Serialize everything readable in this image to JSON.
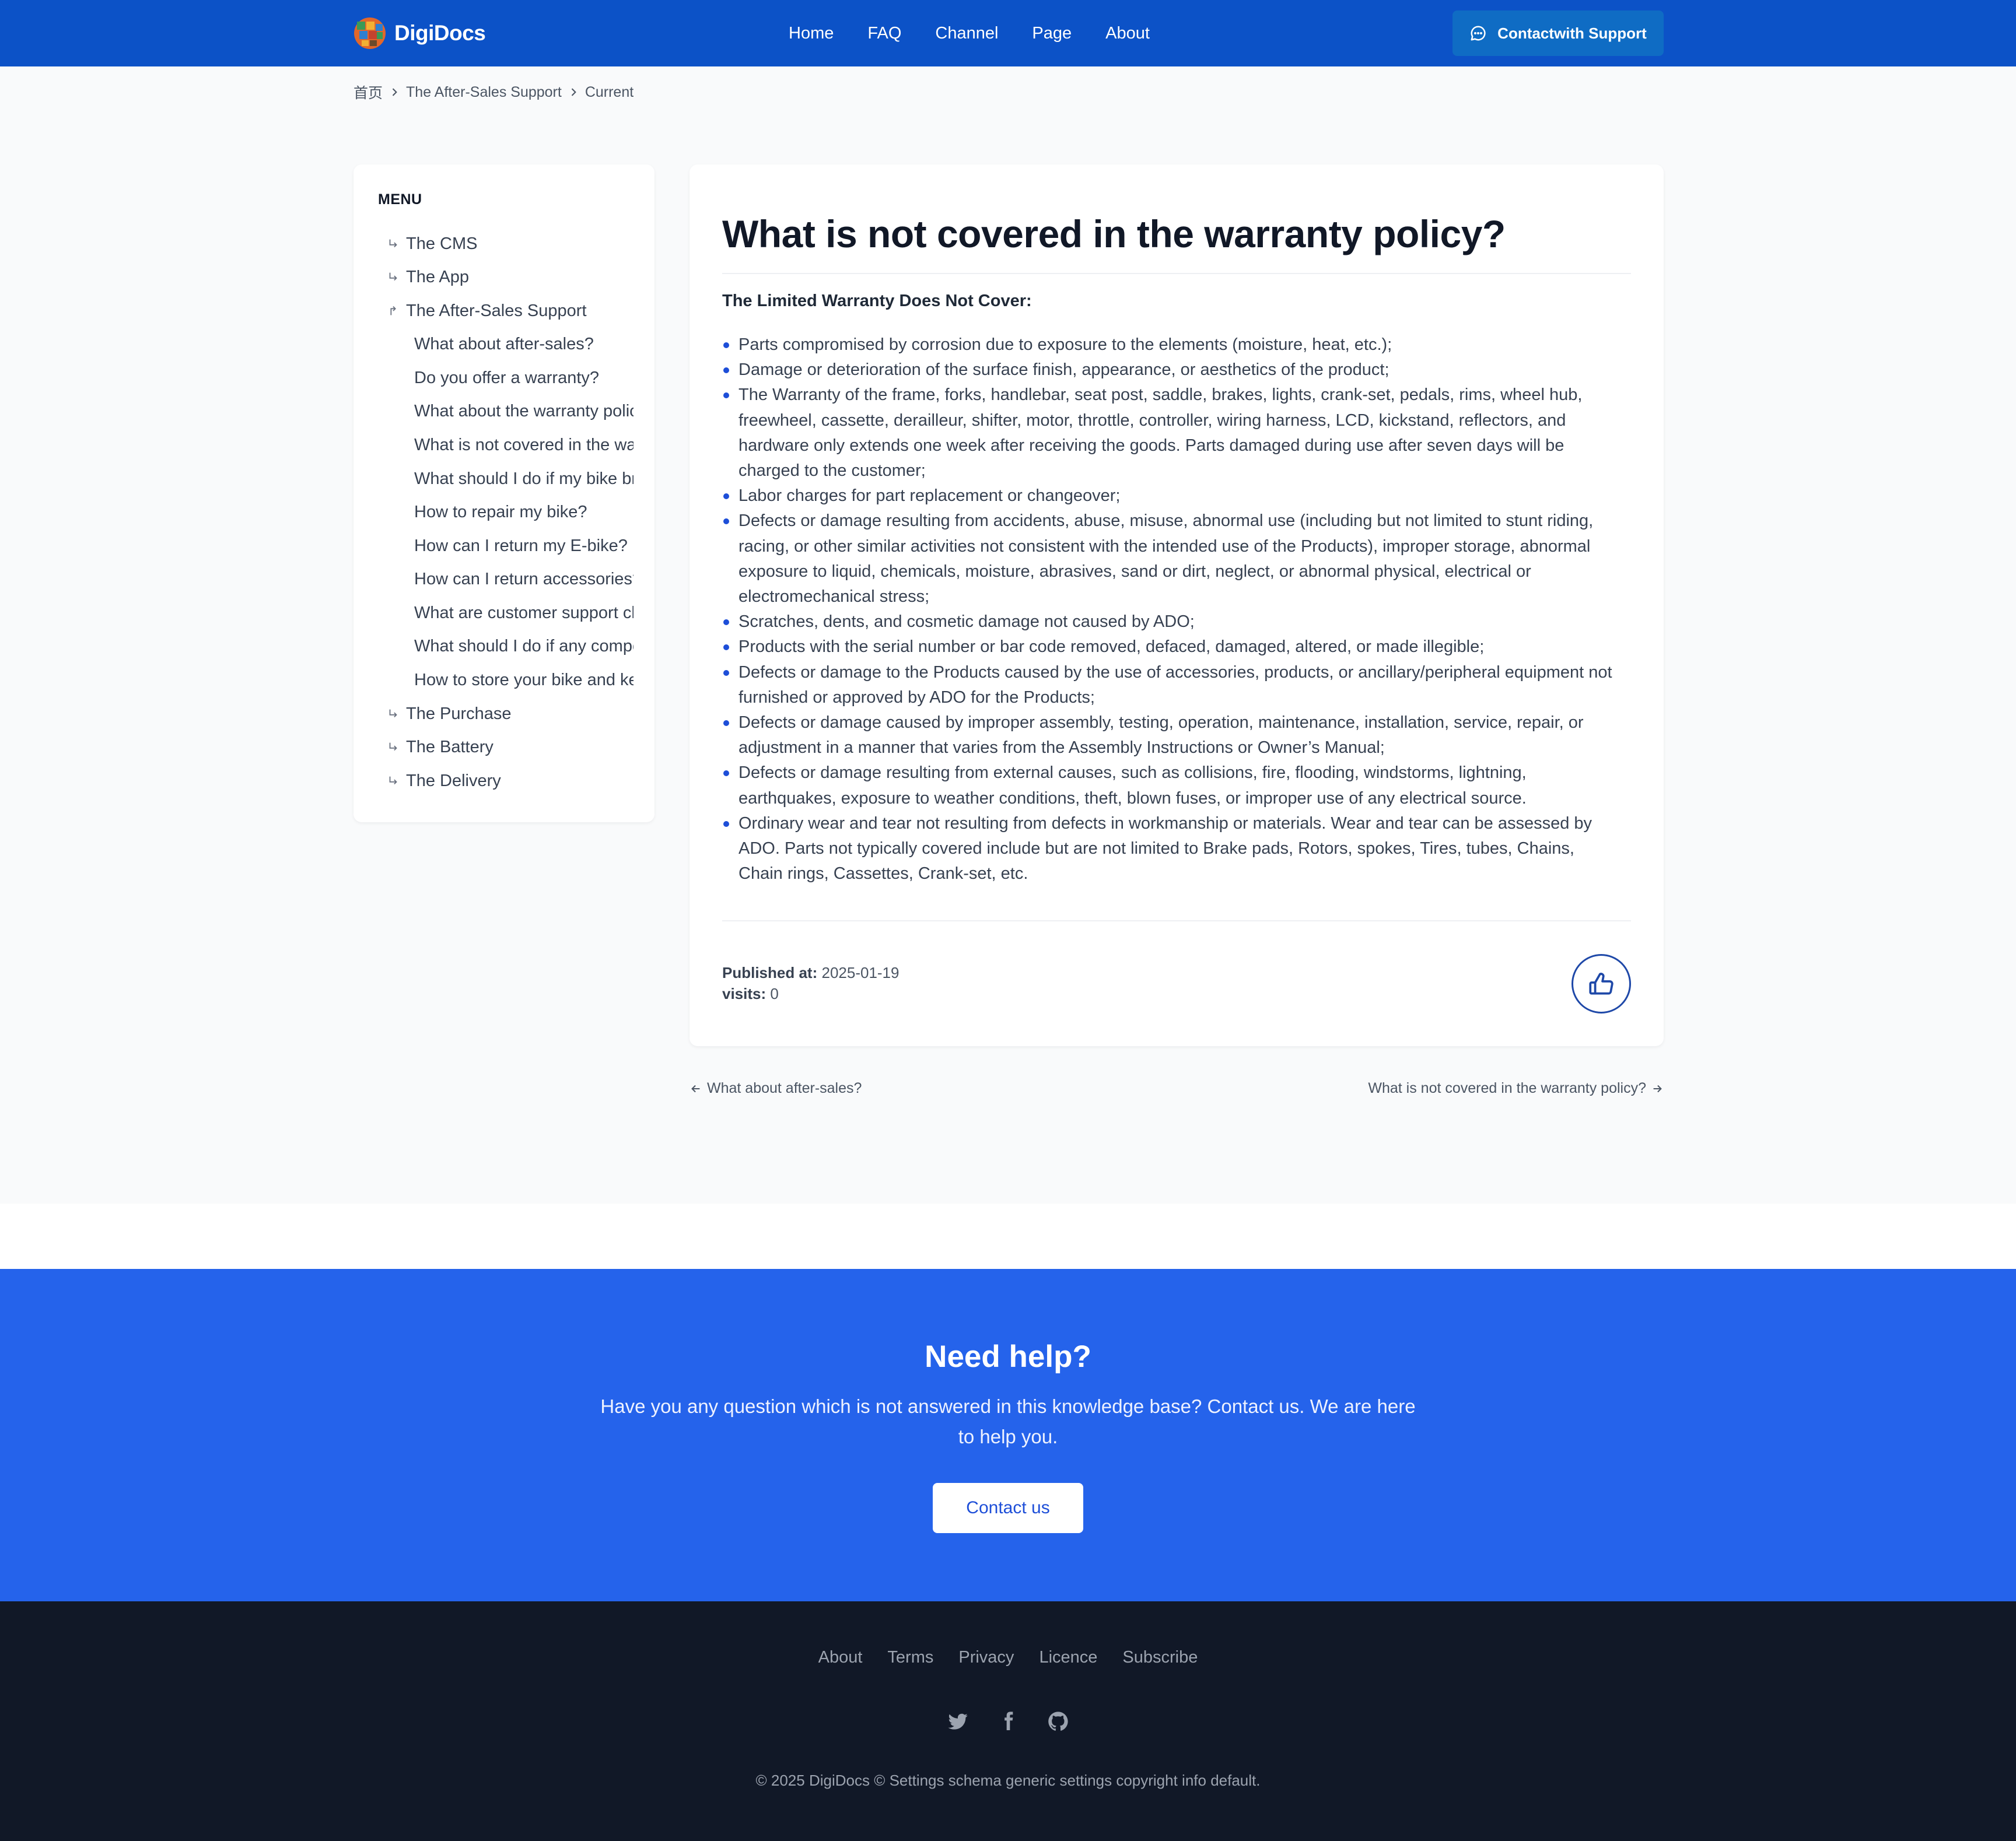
{
  "header": {
    "brand": "DigiDocs",
    "nav": [
      "Home",
      "FAQ",
      "Channel",
      "Page",
      "About"
    ],
    "support_button": "Contactwith Support"
  },
  "breadcrumb": [
    "首页",
    "The After-Sales Support",
    "Current"
  ],
  "sidebar": {
    "title": "MENU",
    "sections": [
      {
        "label": "The CMS",
        "expanded": false
      },
      {
        "label": "The App",
        "expanded": false
      },
      {
        "label": "The After-Sales Support",
        "expanded": true
      },
      {
        "label": "The Purchase",
        "expanded": false
      },
      {
        "label": "The Battery",
        "expanded": false
      },
      {
        "label": "The Delivery",
        "expanded": false
      }
    ],
    "children": [
      "What about after-sales?",
      "Do you offer a warranty?",
      "What about the warranty policy?",
      "What is not covered in the warranty policy?",
      "What should I do if my bike breaks?",
      "How to repair my bike?",
      "How can I return my E-bike?",
      "How can I return accessories?",
      "What are customer support channels?",
      "What should I do if any component is missing?",
      "How to store your bike and keep it safe?"
    ]
  },
  "article": {
    "title": "What is not covered in the warranty policy?",
    "subheading": "The Limited Warranty Does Not Cover:",
    "items": [
      "Parts compromised by corrosion due to exposure to the elements (moisture, heat, etc.);",
      "Damage or deterioration of the surface finish, appearance, or aesthetics of the product;",
      "The Warranty of the frame, forks, handlebar, seat post, saddle, brakes, lights, crank-set, pedals, rims, wheel hub, freewheel, cassette, derailleur, shifter, motor, throttle, controller, wiring harness, LCD, kickstand, reflectors, and hardware only extends one week after receiving the goods. Parts damaged during use after seven days will be charged to the customer;",
      "Labor charges for part replacement or changeover;",
      "Defects or damage resulting from accidents, abuse, misuse, abnormal use (including but not limited to stunt riding, racing, or other similar activities not consistent with the intended use of the Products), improper storage, abnormal exposure to liquid, chemicals, moisture, abrasives, sand or dirt, neglect, or abnormal physical, electrical or electromechanical stress;",
      "Scratches, dents, and cosmetic damage not caused by ADO;",
      "Products with the serial number or bar code removed, defaced, damaged, altered, or made illegible;",
      "Defects or damage to the Products caused by the use of accessories, products, or ancillary/peripheral equipment not furnished or approved by ADO for the Products;",
      "Defects or damage caused by improper assembly, testing, operation, maintenance, installation, service, repair, or adjustment in a manner that varies from the Assembly Instructions or Owner’s Manual;",
      "Defects or damage resulting from external causes, such as collisions, fire, flooding, windstorms, lightning, earthquakes, exposure to weather conditions, theft, blown fuses, or improper use of any electrical source.",
      "Ordinary wear and tear not resulting from defects in workmanship or materials. Wear and tear can be assessed by ADO. Parts not typically covered include but are not limited to Brake pads, Rotors, spokes, Tires, tubes, Chains, Chain rings, Cassettes, Crank-set, etc."
    ],
    "published_label": "Published at:",
    "published_value": "2025-01-19",
    "visits_label": "visits:",
    "visits_value": "0"
  },
  "pager": {
    "prev": "What about after-sales?",
    "next": "What is not covered in the warranty policy?"
  },
  "help": {
    "title": "Need help?",
    "text": "Have you any question which is not answered in this knowledge base? Contact us. We are here to help you.",
    "button": "Contact us"
  },
  "footer": {
    "links": [
      "About",
      "Terms",
      "Privacy",
      "Licence",
      "Subscribe"
    ],
    "social_icons": [
      "twitter-icon",
      "facebook-icon",
      "github-icon"
    ],
    "copyright": "© 2025 DigiDocs © Settings schema generic settings copyright info default."
  },
  "colors": {
    "header": "#0c52c7",
    "accent": "#2563eb",
    "footer": "#111827"
  }
}
